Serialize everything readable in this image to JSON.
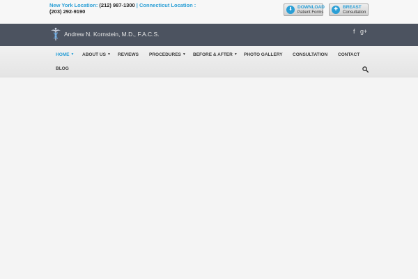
{
  "top": {
    "ny_label": "New York Location: ",
    "ny_phone": "(212) 987-1300",
    "sep": " | ",
    "ct_label": "Connecticut Location :",
    "ct_phone": "(203) 292-9190"
  },
  "buttons": {
    "download": {
      "title": "DOWNLOAD",
      "subtitle": "Patient Forms"
    },
    "breast": {
      "title": "BREAST",
      "subtitle": "Consultation"
    }
  },
  "brand": {
    "name": "Andrew N. Kornstein, M.D., F.A.C.S."
  },
  "social": {
    "facebook": "f",
    "google": "g+"
  },
  "nav": {
    "home": "HOME",
    "about": "ABOUT US",
    "reviews": "REVIEWS",
    "procedures": "PROCEDURES",
    "before_after": "BEFORE & AFTER",
    "gallery": "PHOTO GALLERY",
    "consultation": "CONSULTATION",
    "contact": "CONTACT",
    "blog": "BLOG"
  },
  "icons": {
    "logo": "caduceus-icon",
    "search": "search-icon",
    "download": "download-icon",
    "consult": "consultation-icon"
  },
  "colors": {
    "accent": "#2a9fd6",
    "header_band": "#4c5360",
    "nav_bg": "#eaeaea",
    "page_bg": "#f4f4f4"
  }
}
